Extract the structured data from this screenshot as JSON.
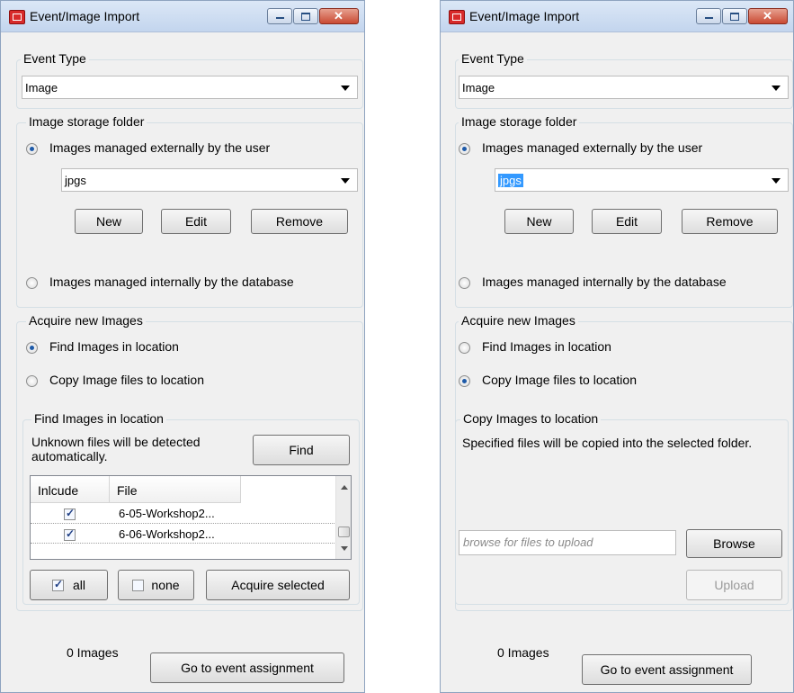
{
  "left": {
    "title": "Event/Image Import",
    "event_type": {
      "label": "Event Type",
      "value": "Image"
    },
    "storage": {
      "label": "Image storage folder",
      "option_external": "Images managed externally by the user",
      "folder_value": "jpgs",
      "new": "New",
      "edit": "Edit",
      "remove": "Remove",
      "option_internal": "Images managed internally by the database"
    },
    "acquire": {
      "label": "Acquire new Images",
      "option_find": "Find Images in location",
      "option_copy": "Copy Image files to location"
    },
    "find": {
      "label": "Find Images in location",
      "description": "Unknown files will be detected automatically.",
      "find_button": "Find",
      "columns": [
        "Inlcude",
        "File"
      ],
      "rows": [
        {
          "include": true,
          "file": "6-05-Workshop2..."
        },
        {
          "include": true,
          "file": "6-06-Workshop2..."
        }
      ],
      "all": "all",
      "none": "none",
      "acquire_selected": "Acquire selected"
    },
    "footer": {
      "count": "0 Images",
      "go": "Go to event assignment"
    }
  },
  "right": {
    "title": "Event/Image Import",
    "event_type": {
      "label": "Event Type",
      "value": "Image"
    },
    "storage": {
      "label": "Image storage folder",
      "option_external": "Images managed externally by the user",
      "folder_value": "jpgs",
      "new": "New",
      "edit": "Edit",
      "remove": "Remove",
      "option_internal": "Images managed internally by the database"
    },
    "acquire": {
      "label": "Acquire new Images",
      "option_find": "Find Images in location",
      "option_copy": "Copy Image files to location"
    },
    "copy": {
      "label": "Copy Images to location",
      "description": "Specified files will be copied into the selected folder.",
      "placeholder": "browse for files to upload",
      "browse": "Browse",
      "upload": "Upload"
    },
    "footer": {
      "count": "0 Images",
      "go": "Go to event assignment"
    }
  }
}
